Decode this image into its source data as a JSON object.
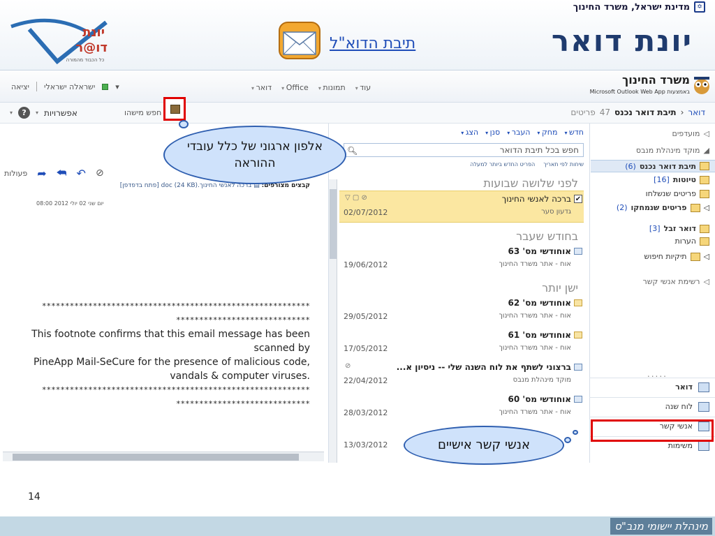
{
  "slide": {
    "gov_line": "מדינת ישראל, משרד החינוך",
    "title": "יונת דואר",
    "mailbox_link": "תיבת הדוא\"ל",
    "logo_text_top": "יונת",
    "logo_text_bottom": "דו@ר",
    "logo_caption": "כל הכבוד מהמורה",
    "page_number": "14",
    "footer": "מינהלת יישומי מנב\"ס"
  },
  "owa": {
    "ministry": "משרד החינוך",
    "app_name": "Microsoft Outlook Web App",
    "app_sub": "באמצעות",
    "menu": [
      "דואר",
      "Office",
      "תמונות",
      "עוד"
    ],
    "user": "ישראלה ישראלי",
    "signout": "יציאה",
    "breadcrumb": {
      "root": "דואר",
      "folder": "תיבת דואר נכנס",
      "count": "47",
      "count_label": "פריטים"
    },
    "options": "אפשרויות",
    "search_people": "חפש מישהו",
    "help": "?"
  },
  "nav": {
    "favorites": "מועדפים",
    "group": "מוקד מינהלת מנבס",
    "inbox": "תיבת דואר נכנס",
    "inbox_count": "(6)",
    "drafts": "טיוטות",
    "drafts_count": "[16]",
    "sent": "פריטים שנשלחו",
    "deleted": "פריטים שנמחקו",
    "deleted_count": "(2)",
    "junk": "דואר זבל",
    "junk_count": "[3]",
    "notes": "הערות",
    "search_folders": "תיקיות חיפוש",
    "contact_list": "רשימת אנשי קשר",
    "dots": ".....",
    "tabs": [
      "דואר",
      "לוח שנה",
      "אנשי קשר",
      "משימות"
    ]
  },
  "list": {
    "toolbar": [
      "חדש",
      "מחק",
      "העבר",
      "סנן",
      "הצג"
    ],
    "search_placeholder": "חפש בכל תיבת הדואר",
    "sort_by": "שיחות לפי תאריך",
    "sort_order": "הפריט החדש ביותר למעלה",
    "groups": [
      "לפני שלושה שבועות",
      "בחודש שעבר",
      "ישן יותר"
    ],
    "messages": [
      {
        "subject": "ברכה לאנשי החינוך",
        "from": "גדעון סער",
        "date": "02/07/2012"
      },
      {
        "subject": "אוחודשי מס' 63",
        "from": "אוח - אתר משרד החינוך",
        "date": "19/06/2012"
      },
      {
        "subject": "אוחודשי מס' 62",
        "from": "אוח - אתר משרד החינוך",
        "date": "29/05/2012"
      },
      {
        "subject": "אוחודשי מס' 61",
        "from": "אוח - אתר משרד החינוך",
        "date": "17/05/2012"
      },
      {
        "subject": "ברצוני לשתף את לוח השנה שלי -- ניסיון א...",
        "from": "מוקד מינהלת מנבס",
        "date": "22/04/2012"
      },
      {
        "subject": "אוחודשי מס' 60",
        "from": "אוח - אתר משרד החינוך",
        "date": "28/03/2012"
      },
      {
        "subject": "",
        "from": "",
        "date": "13/03/2012"
      }
    ]
  },
  "reading": {
    "actions": "פעולות",
    "attach_label": "קבצים מצורפים:",
    "attach_file": "ברכה לאנשי החינוך.doc (24 KB)",
    "attach_open": "[פתח בדפדפן]",
    "date_line": "יום שני 02 יולי 2012 08:00",
    "stars_long": "**********************************************************",
    "stars_short": "*****************************",
    "footnote1": "This footnote confirms that this email message has been scanned by",
    "footnote2": "PineApp Mail-SeCure for the presence of malicious code, vandals & computer viruses."
  },
  "callouts": {
    "addressbook": "אלפון ארגוני של כלל עובדי ההוראה",
    "contacts": "אנשי קשר אישיים"
  }
}
